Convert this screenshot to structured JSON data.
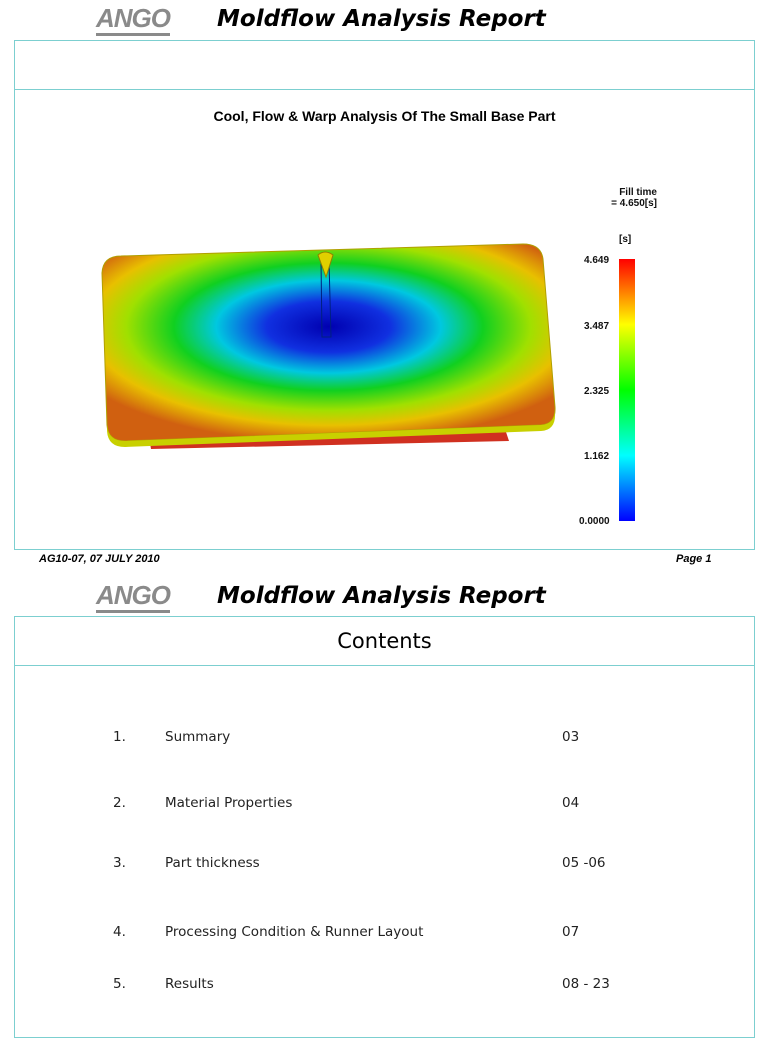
{
  "page1": {
    "logo": "ANGO",
    "header_title": "Moldflow Analysis Report",
    "figure_title": "Cool, Flow & Warp Analysis Of The Small Base Part",
    "legend": {
      "title_line1": "Fill time",
      "title_line2": "= 4.650[s]",
      "unit": "[s]",
      "ticks": [
        "4.649",
        "3.487",
        "2.325",
        "1.162",
        "0.0000"
      ]
    },
    "footer_left": "AG10-07, 07 JULY 2010",
    "footer_right": "Page 1"
  },
  "page2": {
    "logo": "ANGO",
    "header_title": "Moldflow Analysis Report",
    "contents_title": "Contents",
    "items": [
      {
        "num": "1.",
        "label": "Summary",
        "page": "03"
      },
      {
        "num": "2.",
        "label": "Material Properties",
        "page": "04"
      },
      {
        "num": "3.",
        "label": "Part thickness",
        "page": "05 -06"
      },
      {
        "num": "4.",
        "label": "Processing Condition & Runner Layout",
        "page": "07"
      },
      {
        "num": "5.",
        "label": "Results",
        "page": "08 - 23"
      }
    ]
  }
}
